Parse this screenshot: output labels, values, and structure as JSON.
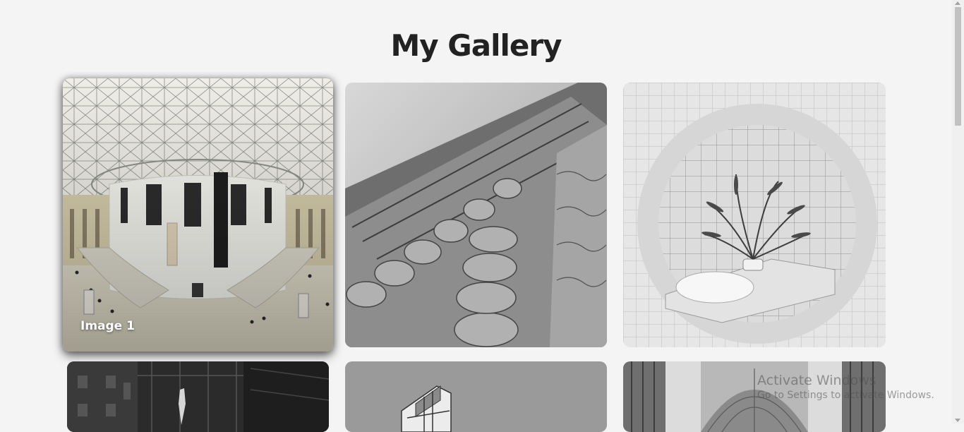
{
  "gallery": {
    "title": "My Gallery",
    "images": [
      {
        "caption": "Image 1",
        "subject": "museum-dome-interior"
      },
      {
        "subject": "gothic-facade-columns"
      },
      {
        "subject": "plant-in-tiled-bathroom"
      },
      {
        "subject": "dark-building-corner"
      },
      {
        "subject": "modern-balcony-building"
      },
      {
        "subject": "colonnade-ceiling"
      }
    ]
  },
  "watermark": {
    "line1": "Activate Windows",
    "line2": "Go to Settings to activate Windows."
  }
}
